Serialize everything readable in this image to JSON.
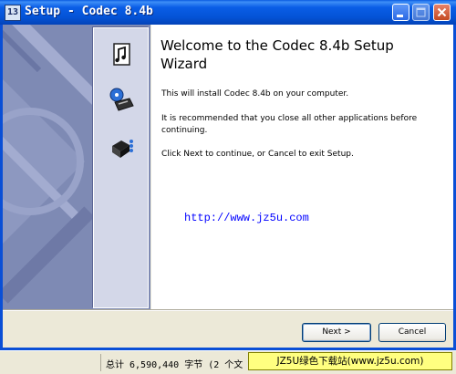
{
  "window": {
    "title": "Setup - Codec 8.4b",
    "icon": "setup-app-icon",
    "icon_text": "13"
  },
  "banner": {
    "icons": [
      "music-document-icon",
      "disc-install-icon",
      "package-install-icon"
    ]
  },
  "content": {
    "heading": "Welcome to the Codec 8.4b Setup Wizard",
    "paragraph_1": "This will install Codec 8.4b on your computer.",
    "paragraph_2": "It is recommended that you close all other applications before continuing.",
    "paragraph_3": "Click Next to continue, or Cancel to exit Setup.",
    "url_text": "http://www.jz5u.com"
  },
  "buttons": {
    "next_label": "Next >",
    "cancel_label": "Cancel"
  },
  "statusbar": {
    "text": "总计 6,590,440 字节 (2 个文",
    "site_badge": "JZ5U绿色下载站(www.jz5u.com)"
  },
  "colors": {
    "titlebar": "#0a5de6",
    "banner": "#7e8ab4",
    "url_text": "#0000ff",
    "site_badge_bg": "#ffff80"
  }
}
